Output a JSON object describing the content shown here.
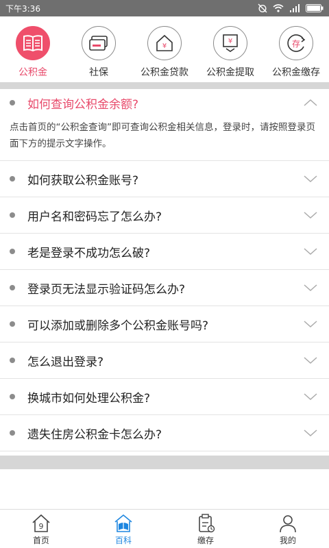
{
  "status_bar": {
    "time": "下午3:36"
  },
  "categories": [
    {
      "label": "公积金",
      "icon": "book-icon",
      "active": true
    },
    {
      "label": "社保",
      "icon": "card-icon",
      "active": false
    },
    {
      "label": "公积金贷款",
      "icon": "house-yen-icon",
      "active": false
    },
    {
      "label": "公积金提取",
      "icon": "withdraw-yen-icon",
      "active": false
    },
    {
      "label": "公积金缴存",
      "icon": "deposit-icon",
      "active": false
    }
  ],
  "deposit_icon_char": "存",
  "yen_char": "¥",
  "faq": {
    "open_question": "如何查询公积金余额?",
    "open_answer": "点击首页的“公积金查询”即可查询公积金相关信息，登录时，请按照登录页面下方的提示文字操作。",
    "questions": [
      "如何获取公积金账号?",
      "用户名和密码忘了怎么办?",
      "老是登录不成功怎么破?",
      "登录页无法显示验证码怎么办?",
      "可以添加或删除多个公积金账号吗?",
      "怎么退出登录?",
      "换城市如何处理公积金?",
      "遗失住房公积金卡怎么办?"
    ]
  },
  "tabs": [
    {
      "label": "首页",
      "icon": "home-icon",
      "active": false
    },
    {
      "label": "百科",
      "icon": "encyclopedia-icon",
      "active": true
    },
    {
      "label": "缴存",
      "icon": "clipboard-icon",
      "active": false
    },
    {
      "label": "我的",
      "icon": "person-icon",
      "active": false
    }
  ],
  "colors": {
    "accent": "#e8496a",
    "tab_active": "#1d86e0",
    "status_bar": "#6f6f6f",
    "band": "#d6d6d6"
  }
}
